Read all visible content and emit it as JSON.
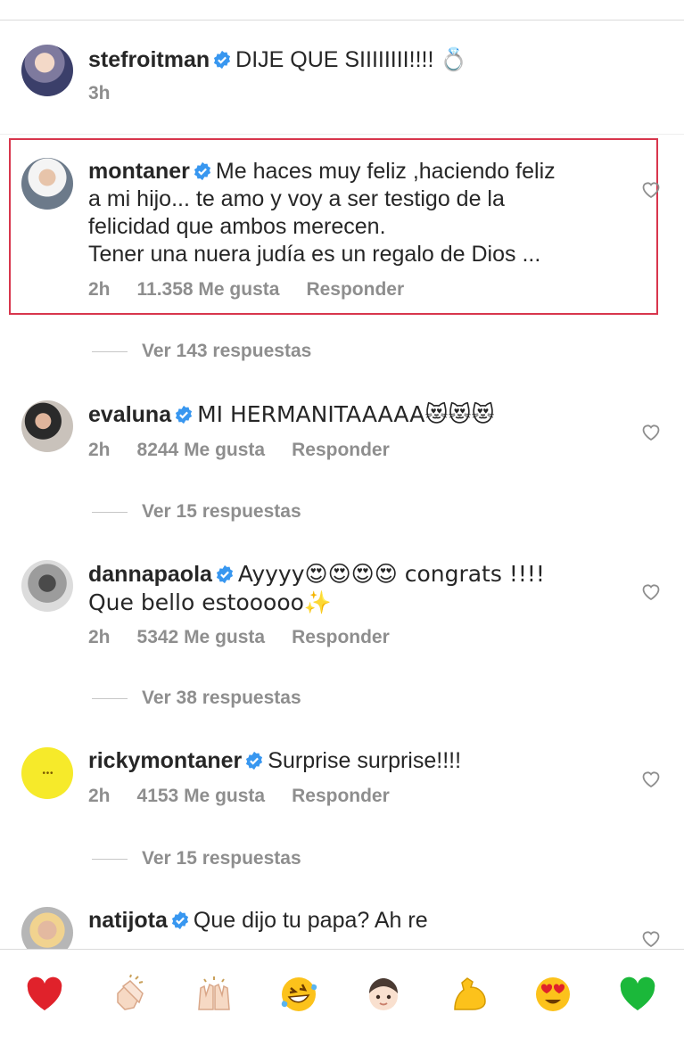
{
  "caption": {
    "username": "stefroitman",
    "text": "DIJE QUE SIIIIIIII!!!! 💍",
    "time": "3h"
  },
  "comments": [
    {
      "username": "montaner",
      "text_lines": [
        "Me haces muy feliz ,haciendo feliz",
        "a mi hijo... te amo y voy a ser testigo de la",
        "felicidad que ambos merecen.",
        "Tener una nuera judía es un regalo de Dios ..."
      ],
      "time": "2h",
      "likes": "11.358 Me gusta",
      "reply": "Responder",
      "view_replies": "Ver 143 respuestas",
      "highlighted": true
    },
    {
      "username": "evaluna",
      "text": "MI HERMANITAAAAA😻😻😻",
      "time": "2h",
      "likes": "8244 Me gusta",
      "reply": "Responder",
      "view_replies": "Ver 15 respuestas"
    },
    {
      "username": "dannapaola",
      "text_line1": "Ayyyy😍😍😍😍 congrats !!!!",
      "text_line2": "Que bello estooooo✨",
      "time": "2h",
      "likes": "5342 Me gusta",
      "reply": "Responder",
      "view_replies": "Ver 38 respuestas"
    },
    {
      "username": "rickymontaner",
      "text": "Surprise surprise!!!!",
      "time": "2h",
      "likes": "4153 Me gusta",
      "reply": "Responder",
      "view_replies": "Ver 15 respuestas"
    },
    {
      "username": "natijota",
      "text": "Que dijo tu papa? Ah re"
    }
  ],
  "reactions": [
    "red-heart",
    "clapping-hands",
    "raising-hands",
    "rolling-laughing-face",
    "child-face",
    "flexed-biceps",
    "heart-eyes-face",
    "green-heart"
  ],
  "colors": {
    "verified_blue": "#3897f0",
    "highlight_red": "#d8364d",
    "meta_gray": "#8e8e8e",
    "text": "#262626"
  }
}
